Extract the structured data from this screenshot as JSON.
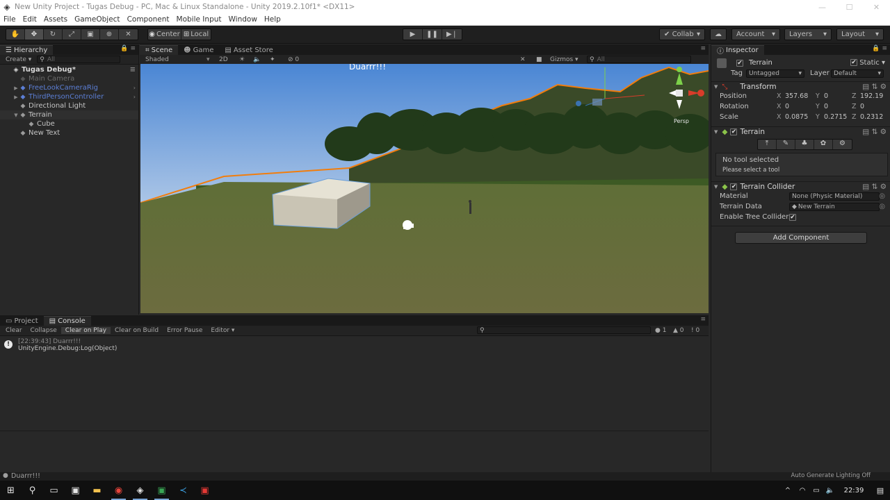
{
  "window": {
    "title": "New Unity Project - Tugas Debug - PC, Mac & Linux Standalone - Unity 2019.2.10f1* <DX11>",
    "minimize": "—",
    "maximize": "☐",
    "close": "✕"
  },
  "menu": [
    "File",
    "Edit",
    "Assets",
    "GameObject",
    "Component",
    "Mobile Input",
    "Window",
    "Help"
  ],
  "toolbar": {
    "pivot": "Center",
    "space": "Local",
    "collab": "Collab",
    "account": "Account",
    "layers": "Layers",
    "layout": "Layout"
  },
  "hierarchy": {
    "tab": "Hierarchy",
    "create": "Create",
    "search_placeholder": "All",
    "scene": "Tugas Debug*",
    "items": [
      {
        "label": "Main Camera",
        "state": "disabled",
        "indent": 1,
        "arrow": ""
      },
      {
        "label": "FreeLookCameraRig",
        "state": "prefab",
        "indent": 1,
        "arrow": "▶"
      },
      {
        "label": "ThirdPersonController",
        "state": "prefab",
        "indent": 1,
        "arrow": "▶"
      },
      {
        "label": "Directional Light",
        "state": "normal",
        "indent": 1,
        "arrow": ""
      },
      {
        "label": "Terrain",
        "state": "selected",
        "indent": 1,
        "arrow": "▼"
      },
      {
        "label": "Cube",
        "state": "normal",
        "indent": 2,
        "arrow": ""
      },
      {
        "label": "New Text",
        "state": "normal",
        "indent": 1,
        "arrow": ""
      }
    ]
  },
  "scene": {
    "tabs": [
      "Scene",
      "Game",
      "Asset Store"
    ],
    "shading": "Shaded",
    "mode2d": "2D",
    "effects_count": "0",
    "gizmos": "Gizmos",
    "search_placeholder": "All",
    "overlay_text": "Duarrr!!!",
    "persp": "Persp"
  },
  "inspector": {
    "tab": "Inspector",
    "object_name": "Terrain",
    "static_label": "Static",
    "tag_label": "Tag",
    "tag_value": "Untagged",
    "layer_label": "Layer",
    "layer_value": "Default",
    "transform": {
      "title": "Transform",
      "position_label": "Position",
      "position": {
        "x": "357.68",
        "y": "0",
        "z": "192.19"
      },
      "rotation_label": "Rotation",
      "rotation": {
        "x": "0",
        "y": "0",
        "z": "0"
      },
      "scale_label": "Scale",
      "scale": {
        "x": "0.0875",
        "y": "0.2715",
        "z": "0.2312"
      }
    },
    "terrain": {
      "title": "Terrain",
      "no_tool": "No tool selected",
      "please_select": "Please select a tool"
    },
    "collider": {
      "title": "Terrain Collider",
      "material_label": "Material",
      "material_value": "None (Physic Material)",
      "terrain_data_label": "Terrain Data",
      "terrain_data_value": "New Terrain",
      "enable_tree_label": "Enable Tree Colliders"
    },
    "add_component": "Add Component"
  },
  "console": {
    "tabs": [
      "Project",
      "Console"
    ],
    "buttons": [
      "Clear",
      "Collapse",
      "Clear on Play",
      "Clear on Build",
      "Error Pause",
      "Editor"
    ],
    "counts": {
      "info": "1",
      "warn": "0",
      "error": "0"
    },
    "log": {
      "line1": "[22:39:43] Duarrr!!!",
      "line2": "UnityEngine.Debug:Log(Object)"
    }
  },
  "statusbar": {
    "message": "Duarrr!!!",
    "right": "Auto Generate Lighting Off"
  },
  "taskbar": {
    "time": "22:39"
  },
  "colors": {
    "accent": "#3a72b0",
    "selection_outline": "#f27d0c",
    "prefab_text": "#5c7fd6"
  }
}
